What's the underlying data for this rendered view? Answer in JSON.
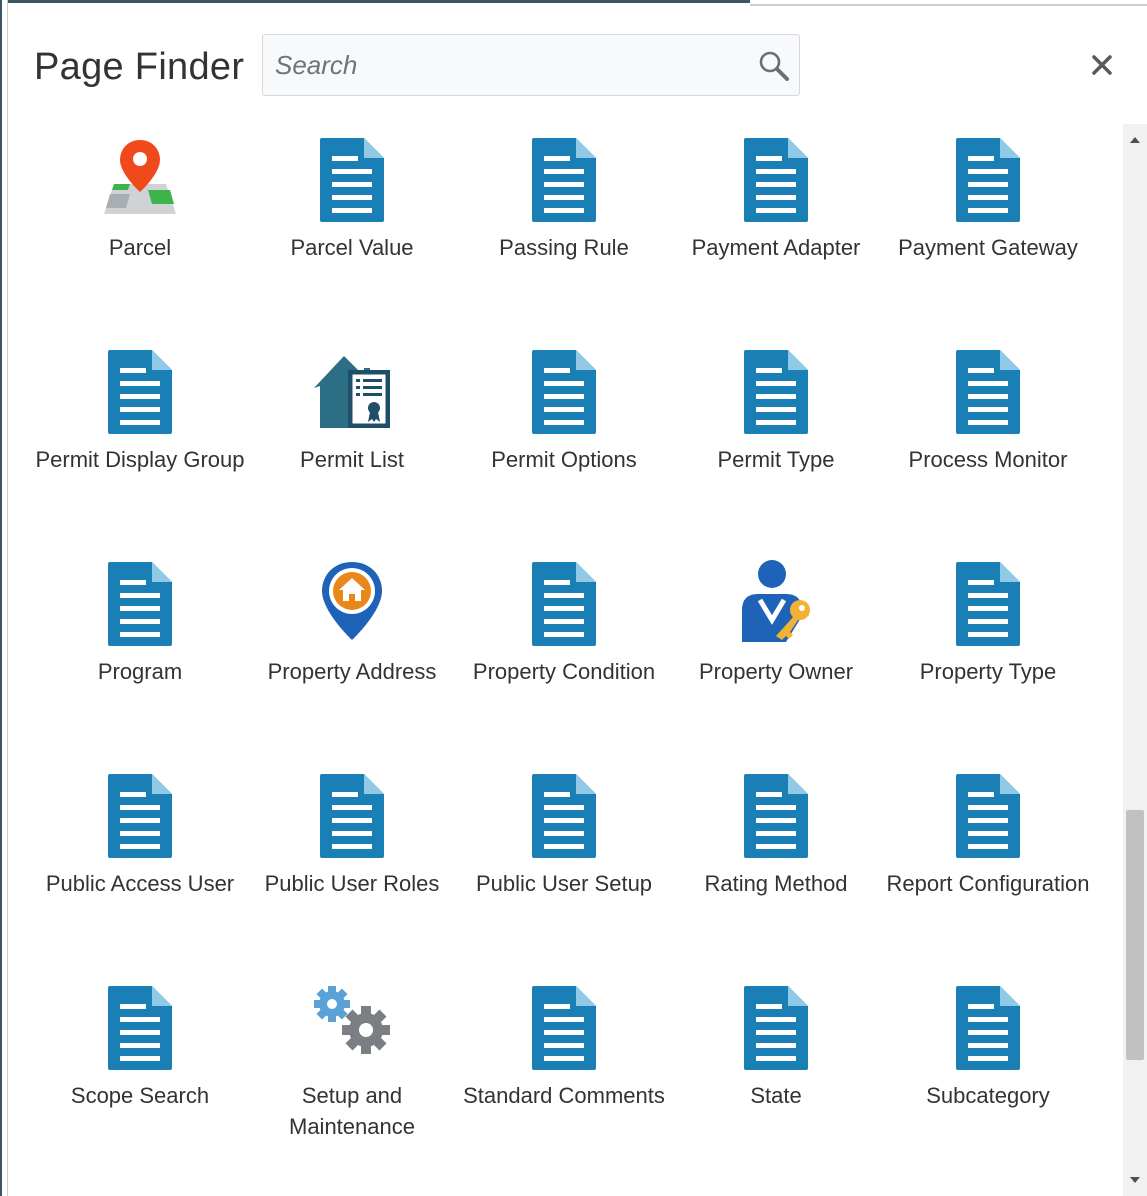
{
  "header": {
    "title": "Page Finder",
    "search_placeholder": "Search",
    "search_value": ""
  },
  "colors": {
    "icon_blue": "#1a7fb4",
    "icon_fold": "#8fc9e6",
    "pin_red": "#f0491b",
    "map_green": "#3cb44a",
    "house_orange": "#e8871a",
    "owner_blue": "#1f63b8",
    "key_gold": "#f2b233",
    "gear_blue": "#5aa2d6",
    "gear_gray": "#7b7f83"
  },
  "tiles": [
    {
      "label": "Parcel",
      "icon": "map-pin-icon"
    },
    {
      "label": "Parcel Value",
      "icon": "document-icon"
    },
    {
      "label": "Passing Rule",
      "icon": "document-icon"
    },
    {
      "label": "Payment Adapter",
      "icon": "document-icon"
    },
    {
      "label": "Payment Gateway",
      "icon": "document-icon"
    },
    {
      "label": "Permit Display Group",
      "icon": "document-icon"
    },
    {
      "label": "Permit List",
      "icon": "house-certificate-icon"
    },
    {
      "label": "Permit Options",
      "icon": "document-icon"
    },
    {
      "label": "Permit Type",
      "icon": "document-icon"
    },
    {
      "label": "Process Monitor",
      "icon": "document-icon"
    },
    {
      "label": "Program",
      "icon": "document-icon"
    },
    {
      "label": "Property Address",
      "icon": "house-location-icon"
    },
    {
      "label": "Property Condition",
      "icon": "document-icon"
    },
    {
      "label": "Property Owner",
      "icon": "owner-key-icon"
    },
    {
      "label": "Property Type",
      "icon": "document-icon"
    },
    {
      "label": "Public Access User",
      "icon": "document-icon"
    },
    {
      "label": "Public User Roles",
      "icon": "document-icon"
    },
    {
      "label": "Public User Setup",
      "icon": "document-icon"
    },
    {
      "label": "Rating Method",
      "icon": "document-icon"
    },
    {
      "label": "Report Configuration",
      "icon": "document-icon"
    },
    {
      "label": "Scope Search",
      "icon": "document-icon"
    },
    {
      "label": "Setup and Maintenance",
      "icon": "gears-icon"
    },
    {
      "label": "Standard Comments",
      "icon": "document-icon"
    },
    {
      "label": "State",
      "icon": "document-icon"
    },
    {
      "label": "Subcategory",
      "icon": "document-icon"
    }
  ]
}
